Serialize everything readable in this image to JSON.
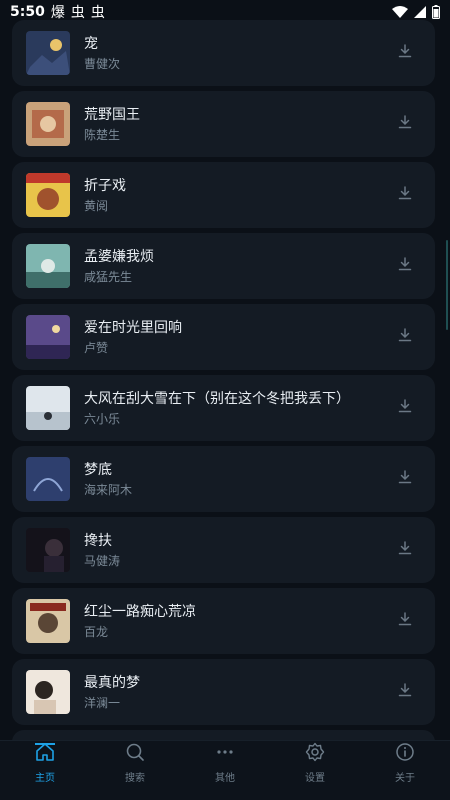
{
  "status_bar": {
    "time": "5:50",
    "notification_icons": [
      "爆",
      "虫",
      "虫"
    ]
  },
  "songs": [
    {
      "title": "宠",
      "artist": "曹健次"
    },
    {
      "title": "荒野国王",
      "artist": "陈楚生"
    },
    {
      "title": "折子戏",
      "artist": "黄阅"
    },
    {
      "title": "孟婆嫌我烦",
      "artist": "咸猛先生"
    },
    {
      "title": "爱在时光里回响",
      "artist": "卢赞"
    },
    {
      "title": "大风在刮大雪在下（别在这个冬把我丢下）",
      "artist": "六小乐"
    },
    {
      "title": "梦底",
      "artist": "海来阿木"
    },
    {
      "title": "搀扶",
      "artist": "马健涛"
    },
    {
      "title": "红尘一路痴心荒凉",
      "artist": "百龙"
    },
    {
      "title": "最真的梦",
      "artist": "洋澜一"
    }
  ],
  "nav": {
    "items": [
      {
        "label": "主页",
        "icon": "home-icon",
        "active": true
      },
      {
        "label": "搜索",
        "icon": "search-icon",
        "active": false
      },
      {
        "label": "其他",
        "icon": "more-icon",
        "active": false
      },
      {
        "label": "设置",
        "icon": "gear-icon",
        "active": false
      },
      {
        "label": "关于",
        "icon": "info-icon",
        "active": false
      }
    ]
  },
  "colors": {
    "background": "#0b1017",
    "card": "#141b24",
    "accent": "#1ea2e6",
    "muted_text": "#7b8a97"
  }
}
